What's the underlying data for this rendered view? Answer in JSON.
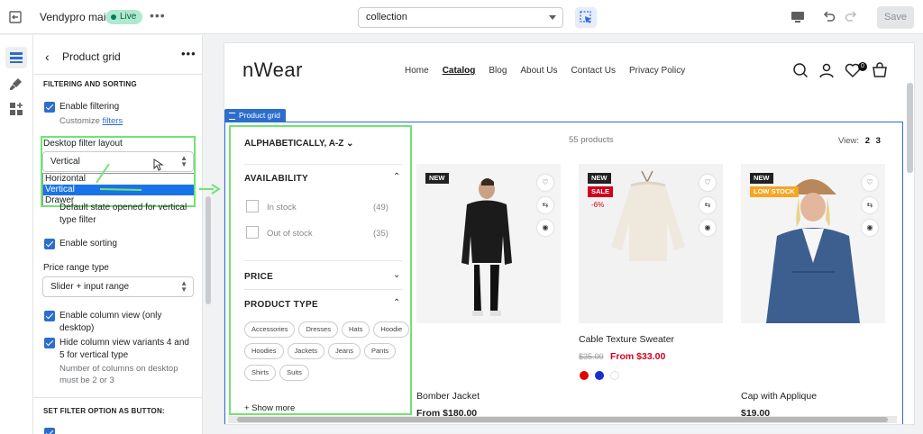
{
  "topbar": {
    "store_name": "Vendypro main",
    "status": "Live",
    "template_select": "collection",
    "save_label": "Save"
  },
  "panel": {
    "title": "Product grid",
    "section_filtering": "FILTERING AND SORTING",
    "enable_filtering": "Enable filtering",
    "customize_prefix": "Customize",
    "customize_link": "filters",
    "desktop_layout_label": "Desktop filter layout",
    "desktop_layout_value": "Vertical",
    "desktop_layout_options": [
      "Horizontal",
      "Vertical",
      "Drawer"
    ],
    "default_state_label": "Default state opened for vertical type filter",
    "enable_sorting": "Enable sorting",
    "price_range_label": "Price range type",
    "price_range_value": "Slider + input range",
    "column_view": "Enable column view (only desktop)",
    "hide_column": "Hide column view variants 4 and 5 for vertical type",
    "hide_column_help": "Number of columns on desktop must be 2 or 3",
    "section_filter_button": "SET FILTER OPTION AS BUTTON:"
  },
  "store": {
    "logo": "nWear",
    "nav": [
      "Home",
      "Catalog",
      "Blog",
      "About Us",
      "Contact Us",
      "Privacy Policy"
    ],
    "cart_count": "0",
    "section_tag": "Product grid",
    "sort_label": "ALPHABETICALLY, A-Z",
    "product_count": "55 products",
    "view_label": "View:",
    "view_options": [
      "2",
      "3"
    ]
  },
  "filters": {
    "availability": "AVAILABILITY",
    "in_stock": "In stock",
    "in_stock_count": "(49)",
    "out_of_stock": "Out of stock",
    "out_of_stock_count": "(35)",
    "price": "PRICE",
    "product_type": "PRODUCT TYPE",
    "types": [
      "Accessories",
      "Dresses",
      "Hats",
      "Hoodie",
      "Hoodies",
      "Jackets",
      "Jeans",
      "Pants",
      "Shirts",
      "Suits"
    ],
    "show_more": "+ Show more"
  },
  "products": [
    {
      "name": "Bomber Jacket",
      "price": "From $180.00",
      "badge": "NEW"
    },
    {
      "name": "Cable Texture Sweater",
      "old_price": "$35.00",
      "price": "From $33.00",
      "badge": "NEW",
      "sale": "SALE",
      "discount": "-6%"
    },
    {
      "name": "Cap with Applique",
      "price": "$19.00",
      "badge": "NEW",
      "low": "LOW STOCK"
    }
  ],
  "colors": {
    "accent": "#2c6ecb",
    "highlight": "#71e471",
    "sale": "#d0021b",
    "swatches": [
      "#e00000",
      "#1b2bd6",
      "#ffffff"
    ]
  }
}
